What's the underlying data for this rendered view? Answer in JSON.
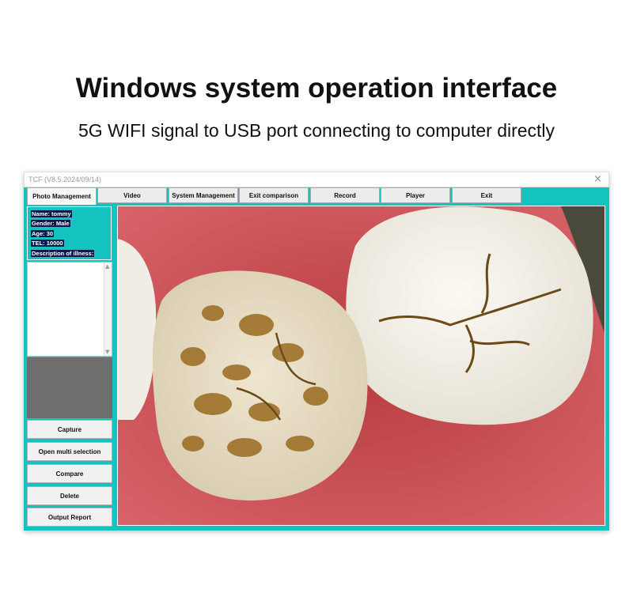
{
  "page": {
    "headline": "Windows system operation interface",
    "subline": "5G WIFI signal to USB port connecting to computer directly"
  },
  "window": {
    "title": "TCF  (V8.5.2024/09/14)",
    "close_glyph": "×"
  },
  "menu": {
    "tabs": [
      {
        "label": "Photo Management",
        "active": true
      },
      {
        "label": "Video"
      },
      {
        "label": "System Management"
      },
      {
        "label": "Exit comparison"
      },
      {
        "label": "Record"
      },
      {
        "label": "Player"
      },
      {
        "label": "Exit"
      }
    ]
  },
  "patient": {
    "name": "Name: tommy",
    "gender": "Gender: Male",
    "age": "Age: 30",
    "tel": "TEL: 10000",
    "description_label": "Description of illness:"
  },
  "actions": {
    "capture": "Capture",
    "multi_select": "Open multi selection",
    "compare": "Compare",
    "delete": "Delete",
    "output_report": "Output Report"
  },
  "viewer": {
    "image": "intraoral-molar-photo",
    "description_value": ""
  },
  "colors": {
    "accent": "#14c2bf",
    "button_bg": "#f1f1f1",
    "gum": "#c9504f",
    "tooth": "#f3efe4",
    "stain": "#9a6a20"
  },
  "icons": {
    "close": "close-icon",
    "scroll_up": "scroll-up-icon",
    "scroll_down": "scroll-down-icon"
  }
}
